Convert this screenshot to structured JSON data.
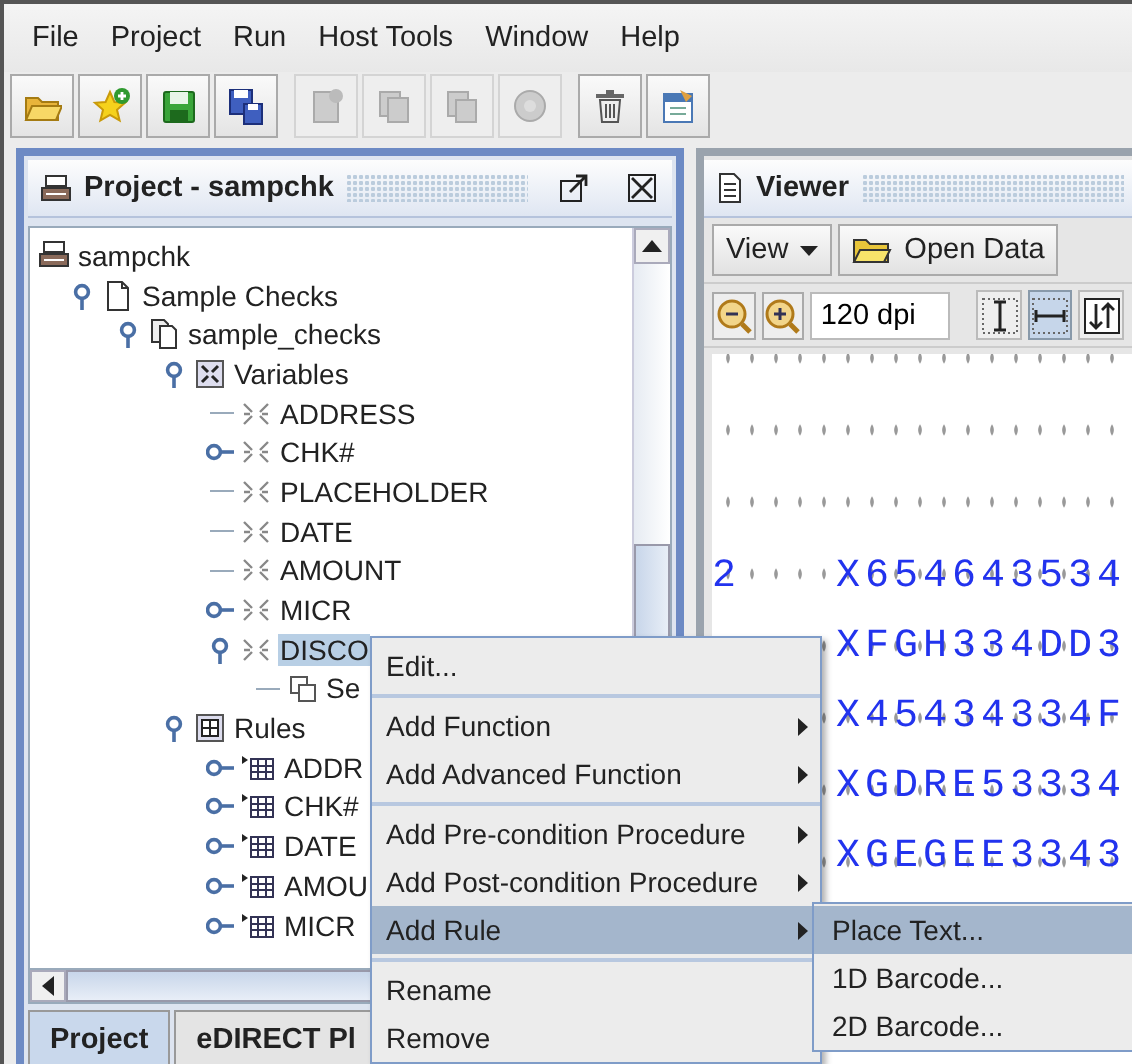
{
  "menu_bar": [
    "File",
    "Project",
    "Run",
    "Host Tools",
    "Window",
    "Help"
  ],
  "toolbar": [
    [
      {
        "kind": "folder",
        "disabled": false
      },
      {
        "kind": "star",
        "disabled": false
      },
      {
        "kind": "floppy",
        "disabled": false
      },
      {
        "kind": "floppies",
        "disabled": false
      }
    ],
    [
      {
        "kind": "page",
        "disabled": true
      },
      {
        "kind": "copy",
        "disabled": true
      },
      {
        "kind": "pages",
        "disabled": true
      },
      {
        "kind": "circle",
        "disabled": true
      }
    ],
    [
      {
        "kind": "trash",
        "disabled": false
      },
      {
        "kind": "clipboard",
        "disabled": false
      }
    ]
  ],
  "project_panel": {
    "title": "Project - sampchk",
    "tree": [
      {
        "label": "sampchk",
        "kind": "root",
        "selected": false,
        "children": [
          {
            "label": "Sample Checks",
            "kind": "page",
            "selected": false,
            "expanded": true,
            "children": [
              {
                "label": "sample_checks",
                "kind": "pages",
                "selected": false,
                "expanded": true,
                "children": [
                  {
                    "label": "Variables",
                    "kind": "variables",
                    "selected": false,
                    "expanded": true,
                    "children": [
                      {
                        "label": "ADDRESS",
                        "kind": "variable",
                        "selected": false
                      },
                      {
                        "label": "CHK#",
                        "kind": "variable",
                        "selected": false,
                        "expanded": false
                      },
                      {
                        "label": "PLACEHOLDER",
                        "kind": "variable",
                        "selected": false
                      },
                      {
                        "label": "DATE",
                        "kind": "variable",
                        "selected": false
                      },
                      {
                        "label": "AMOUNT",
                        "kind": "variable",
                        "selected": false
                      },
                      {
                        "label": "MICR",
                        "kind": "variable",
                        "selected": false,
                        "expanded": false
                      },
                      {
                        "label": "DISCO",
                        "kind": "variable",
                        "selected": true,
                        "expanded": true,
                        "children": [
                          {
                            "label": "Se",
                            "kind": "function",
                            "selected": false
                          }
                        ]
                      }
                    ]
                  },
                  {
                    "label": "Rules",
                    "kind": "rules",
                    "selected": false,
                    "expanded": true,
                    "children": [
                      {
                        "label": "ADDR",
                        "kind": "rule",
                        "selected": false,
                        "expanded": false
                      },
                      {
                        "label": "CHK#",
                        "kind": "rule",
                        "selected": false,
                        "expanded": false
                      },
                      {
                        "label": "DATE",
                        "kind": "rule",
                        "selected": false,
                        "expanded": false
                      },
                      {
                        "label": "AMOU",
                        "kind": "rule",
                        "selected": false,
                        "expanded": false
                      },
                      {
                        "label": "MICR",
                        "kind": "rule",
                        "selected": false,
                        "expanded": false
                      }
                    ]
                  }
                ]
              }
            ]
          }
        ]
      }
    ],
    "tabs": [
      {
        "label": "Project",
        "selected": true
      },
      {
        "label": "eDIRECT Pl",
        "selected": false
      }
    ]
  },
  "viewer_panel": {
    "title": "Viewer",
    "view_menu": "View",
    "open_data": "Open Data",
    "zoom": "120 dpi",
    "toggles": [
      {
        "kind": "vertical",
        "selected": false
      },
      {
        "kind": "horizontal",
        "selected": true
      },
      {
        "kind": "swap",
        "selected": false
      }
    ],
    "lines": [
      {
        "column_1": "2",
        "column_2": "X654643534"
      },
      {
        "column_2": "XFGH334DD3"
      },
      {
        "column_2": "X45434334F"
      },
      {
        "column_2": "XGDRE53334"
      },
      {
        "column_2": "XGEGEE3343"
      }
    ]
  },
  "context_menu": {
    "groups": [
      [
        {
          "label": "Edit...",
          "submenu": false,
          "selected": false
        }
      ],
      [
        {
          "label": "Add Function",
          "submenu": true,
          "selected": false
        },
        {
          "label": "Add Advanced Function",
          "submenu": true,
          "selected": false
        }
      ],
      [
        {
          "label": "Add Pre-condition Procedure",
          "submenu": true,
          "selected": false
        },
        {
          "label": "Add Post-condition Procedure",
          "submenu": true,
          "selected": false
        },
        {
          "label": "Add Rule",
          "submenu": true,
          "selected": true
        }
      ],
      [
        {
          "label": "Rename",
          "submenu": false,
          "selected": false
        },
        {
          "label": "Remove",
          "submenu": false,
          "selected": false
        }
      ]
    ]
  },
  "submenu": [
    {
      "label": "Place Text...",
      "selected": true
    },
    {
      "label": "1D Barcode...",
      "selected": false
    },
    {
      "label": "2D Barcode...",
      "selected": false
    }
  ]
}
